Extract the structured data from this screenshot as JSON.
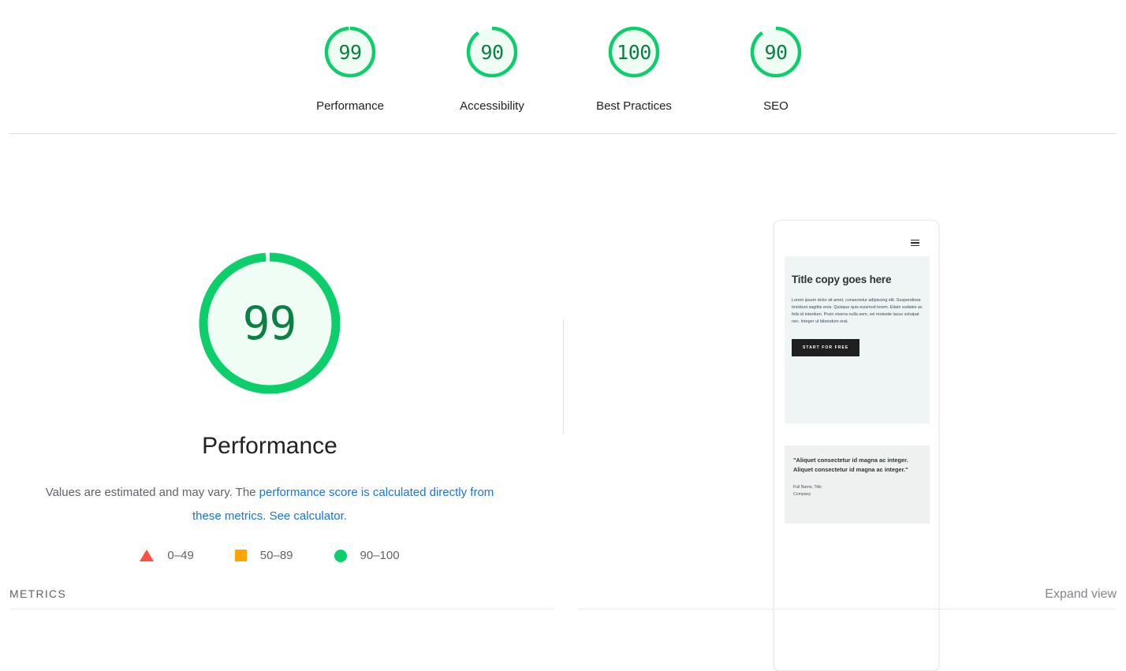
{
  "theme": {
    "pass_color": "#0cce6b",
    "pass_fill": "#f0fdf4",
    "pass_text": "#0b8043",
    "average_color": "#ffa400",
    "fail_color": "#ff4e42",
    "link_color": "#1a73e8"
  },
  "topbar": {
    "gauges": [
      {
        "score": "99",
        "label": "Performance",
        "percent": 99
      },
      {
        "score": "90",
        "label": "Accessibility",
        "percent": 90
      },
      {
        "score": "100",
        "label": "Best Practices",
        "percent": 100
      },
      {
        "score": "90",
        "label": "SEO",
        "percent": 90
      }
    ]
  },
  "category": {
    "score": "99",
    "percent": 99,
    "title": "Performance",
    "description_before": "Values are estimated and may vary. The ",
    "link_calculated": "performance score is calculated directly from these metrics",
    "description_middle": ". ",
    "link_see_calculator": "See calculator.",
    "legend": [
      {
        "marker": "triangle-marker",
        "range": "0–49"
      },
      {
        "marker": "square-marker",
        "range": "50–89"
      },
      {
        "marker": "circle-marker",
        "range": "90–100"
      }
    ]
  },
  "thumbnail": {
    "menu_icon": "hamburger-icon",
    "heading": "Title copy goes here",
    "body": "Lorem ipsum dolor sit amet, consectetur adipiscing elit. Suspendisse tincidunt sagittis eros. Quisque quis euismod lorem. Etiam sodales ac felis id interdum. Proin viverra nulla sem, vel molestie lacus volutpat nec. Integer ut bibendum erat.",
    "cta_label": "START FOR FREE",
    "quote": "\"Aliquet consectetur id magna ac integer. Aliquet consectetur id magna ac integer.\"",
    "attribution_name": "Full Name, Title",
    "attribution_company": "Company"
  },
  "footer": {
    "metrics_label": "METRICS",
    "expand_view_label": "Expand view"
  }
}
